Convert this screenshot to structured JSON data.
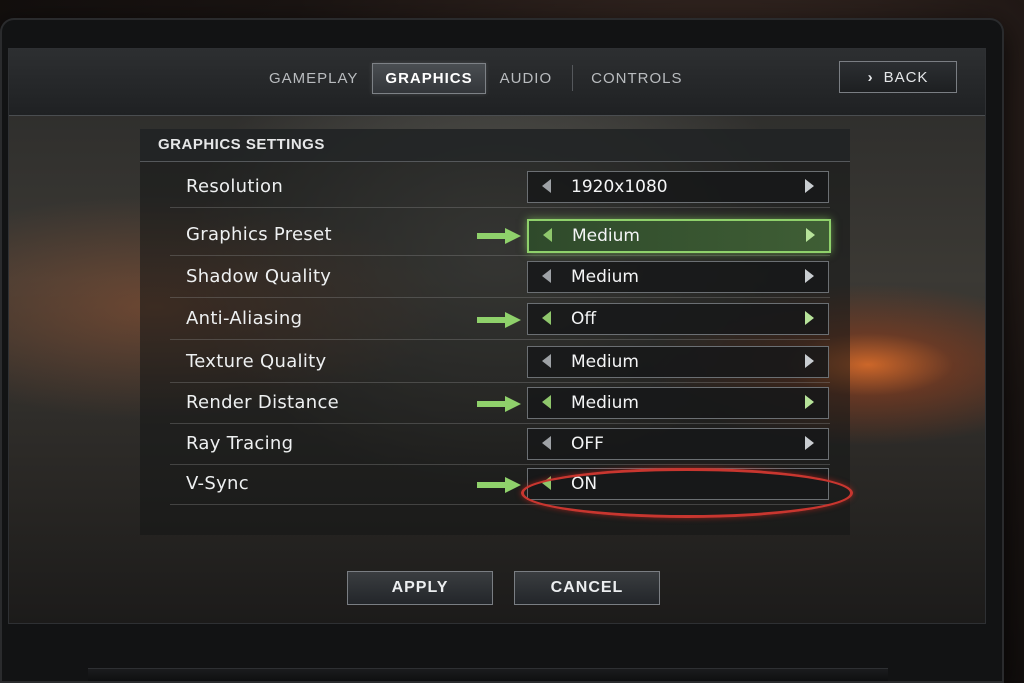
{
  "tabs": [
    {
      "label": "GAMEPLAY",
      "active": false
    },
    {
      "label": "GRAPHICS",
      "active": true
    },
    {
      "label": "AUDIO",
      "active": false
    },
    {
      "label": "CONTROLS",
      "active": false
    }
  ],
  "back_button": {
    "label": "BACK",
    "icon": "chevron-right-icon"
  },
  "panel": {
    "title": "GRAPHICS SETTINGS"
  },
  "settings": [
    {
      "label": "Resolution",
      "value": "1920x1080",
      "highlighted": false,
      "arrow_callout": false
    },
    {
      "label": "Graphics Preset",
      "value": "Medium",
      "highlighted": true,
      "arrow_callout": true
    },
    {
      "label": "Shadow Quality",
      "value": "Medium",
      "highlighted": false,
      "arrow_callout": false
    },
    {
      "label": "Anti-Aliasing",
      "value": "Off",
      "highlighted": false,
      "arrow_callout": true
    },
    {
      "label": "Texture Quality",
      "value": "Medium",
      "highlighted": false,
      "arrow_callout": false
    },
    {
      "label": "Render Distance",
      "value": "Medium",
      "highlighted": false,
      "arrow_callout": true
    },
    {
      "label": "Ray Tracing",
      "value": "OFF",
      "highlighted": false,
      "arrow_callout": false,
      "circled": true
    },
    {
      "label": "V-Sync",
      "value": "ON",
      "highlighted": false,
      "arrow_callout": true
    }
  ],
  "footer": {
    "apply_label": "APPLY",
    "cancel_label": "CANCEL"
  },
  "colors": {
    "accent_green": "#8fd16b",
    "annotation_red": "#c8362f"
  }
}
